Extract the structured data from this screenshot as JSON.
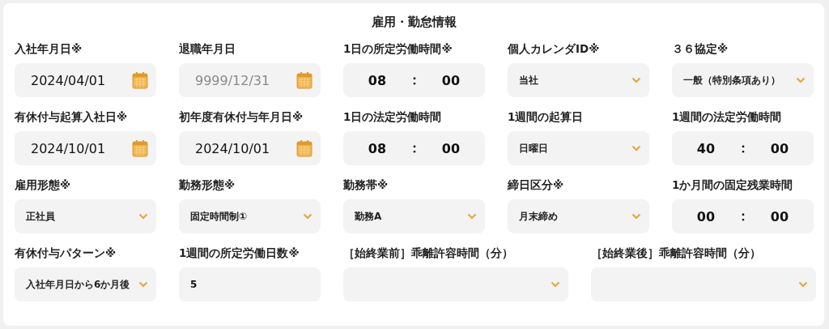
{
  "title": "雇用・勤怠情報",
  "rows": [
    [
      {
        "kind": "date",
        "label": "入社年月日※",
        "value": "2024/04/01"
      },
      {
        "kind": "date",
        "label": "退職年月日",
        "placeholder": "9999/12/31"
      },
      {
        "kind": "time",
        "label": "1日の所定労働時間※",
        "hours": "08",
        "separator": "：",
        "minutes": "00"
      },
      {
        "kind": "select",
        "label": "個人カレンダID※",
        "value": "当社"
      },
      {
        "kind": "select",
        "label": "３６協定※",
        "value": "一般（特別条項あり）"
      }
    ],
    [
      {
        "kind": "date",
        "label": "有休付与起算入社日※",
        "value": "2024/10/01"
      },
      {
        "kind": "date",
        "label": "初年度有休付与年月日※",
        "value": "2024/10/01"
      },
      {
        "kind": "time",
        "label": "1日の法定労働時間",
        "hours": "08",
        "separator": "：",
        "minutes": "00"
      },
      {
        "kind": "select",
        "label": "1週間の起算日",
        "value": "日曜日"
      },
      {
        "kind": "time",
        "label": "1週間の法定労働時間",
        "hours": "40",
        "separator": "：",
        "minutes": "00"
      }
    ],
    [
      {
        "kind": "select",
        "label": "雇用形態※",
        "value": "正社員"
      },
      {
        "kind": "select",
        "label": "勤務形態※",
        "value": "固定時間制①"
      },
      {
        "kind": "select",
        "label": "勤務帯※",
        "value": "勤務A"
      },
      {
        "kind": "select",
        "label": "締日区分※",
        "value": "月末締め"
      },
      {
        "kind": "time",
        "label": "1か月間の固定残業時間",
        "hours": "00",
        "separator": "：",
        "minutes": "00"
      }
    ],
    [
      {
        "kind": "select",
        "label": "有休付与パターン※",
        "value": "入社年月日から6か月後"
      },
      {
        "kind": "text",
        "label": "1週間の所定労働日数※",
        "value": "5"
      },
      {
        "kind": "select",
        "label": "［始終業前］乖離許容時間（分）"
      },
      {
        "kind": "select",
        "label": "［始終業後］乖離許容時間（分）"
      }
    ]
  ]
}
